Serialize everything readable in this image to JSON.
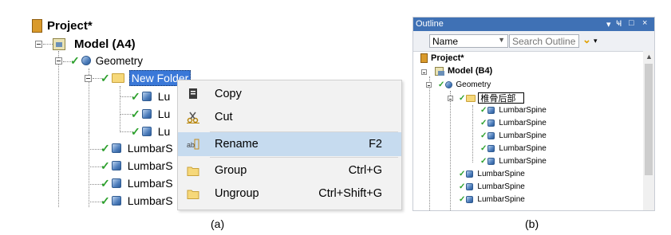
{
  "panel_a": {
    "tree": {
      "project": "Project*",
      "model": "Model (A4)",
      "geometry": "Geometry",
      "new_folder": "New Folder",
      "children": [
        "Lu",
        "Lu",
        "Lu"
      ],
      "siblings": [
        "LumbarS",
        "LumbarS",
        "LumbarS",
        "LumbarS"
      ]
    },
    "context_menu": {
      "items": [
        {
          "label": "Copy",
          "shortcut": "",
          "icon": "copy-icon"
        },
        {
          "label": "Cut",
          "shortcut": "",
          "icon": "cut-icon"
        },
        {
          "label": "Rename",
          "shortcut": "F2",
          "icon": "rename-icon"
        },
        {
          "label": "Group",
          "shortcut": "Ctrl+G",
          "icon": "folder-icon"
        },
        {
          "label": "Ungroup",
          "shortcut": "Ctrl+Shift+G",
          "icon": "folder-icon"
        }
      ]
    },
    "caption": "(a)"
  },
  "panel_b": {
    "title": "Outline",
    "title_controls": [
      "▾",
      "Ҹ",
      "□",
      "×"
    ],
    "filter_select": "Name",
    "search_placeholder": "Search Outline",
    "tree": {
      "project": "Project*",
      "model": "Model (B4)",
      "geometry": "Geometry",
      "folder_rename_value": "椎骨后部",
      "children": [
        "LumbarSpine",
        "LumbarSpine",
        "LumbarSpine",
        "LumbarSpine",
        "LumbarSpine"
      ],
      "siblings": [
        "LumbarSpine",
        "LumbarSpine",
        "LumbarSpine"
      ]
    },
    "caption": "(b)"
  },
  "colors": {
    "selection": "#3a78d8",
    "menu_highlight": "#c6dbef",
    "titlebar": "#3f71b5",
    "check": "#2ca02c"
  }
}
